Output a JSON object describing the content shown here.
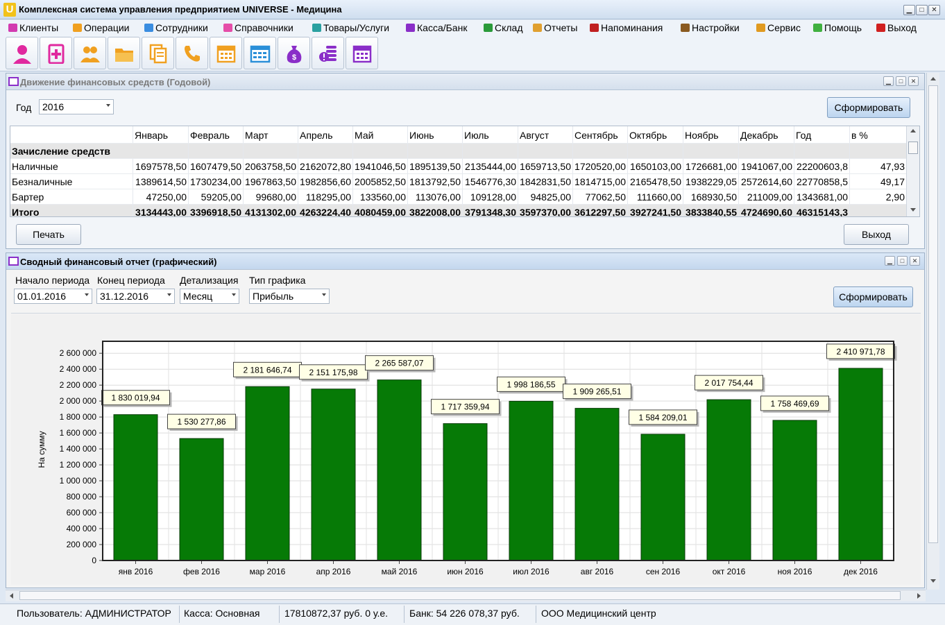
{
  "window": {
    "title": "Комплексная система управления предприятием UNIVERSE - Медицина",
    "logo_letter": "U"
  },
  "menu": [
    {
      "label": "Клиенты",
      "icon": "clients-icon",
      "color": "#d23bb0"
    },
    {
      "label": "Операции",
      "icon": "operations-icon",
      "color": "#f0a020"
    },
    {
      "label": "Сотрудники",
      "icon": "employees-icon",
      "color": "#3a8de0"
    },
    {
      "label": "Справочники",
      "icon": "directories-icon",
      "color": "#e54da8"
    },
    {
      "label": "Товары/Услуги",
      "icon": "goods-icon",
      "color": "#2aa0a0"
    },
    {
      "label": "Касса/Банк",
      "icon": "cash-bank-icon",
      "color": "#8a2ec8"
    },
    {
      "label": "Склад",
      "icon": "warehouse-icon",
      "color": "#2a9a3a"
    },
    {
      "label": "Отчеты",
      "icon": "reports-icon",
      "color": "#e0a030"
    },
    {
      "label": "Напоминания",
      "icon": "reminders-icon",
      "color": "#c02020"
    },
    {
      "label": "Настройки",
      "icon": "settings-icon",
      "color": "#8a5a20"
    },
    {
      "label": "Сервис",
      "icon": "service-icon",
      "color": "#e09a20"
    },
    {
      "label": "Помощь",
      "icon": "help-icon",
      "color": "#40b040"
    },
    {
      "label": "Выход",
      "icon": "exit-icon",
      "color": "#d02020"
    }
  ],
  "toolbar": [
    {
      "icon": "client-person-icon",
      "color": "#e0299f"
    },
    {
      "icon": "medical-card-icon",
      "color": "#e0299f"
    },
    {
      "icon": "staff-group-icon",
      "color": "#f0a020"
    },
    {
      "icon": "folder-icon",
      "color": "#f0a020"
    },
    {
      "icon": "documents-icon",
      "color": "#f0a020"
    },
    {
      "icon": "phone-icon",
      "color": "#f0a020"
    },
    {
      "icon": "calendar-icon",
      "color": "#f0a020"
    },
    {
      "icon": "schedule-grid-icon",
      "color": "#2a8fd8"
    },
    {
      "icon": "money-bag-icon",
      "color": "#8a2ec8"
    },
    {
      "icon": "coins-warning-icon",
      "color": "#8a2ec8"
    },
    {
      "icon": "calendar-purple-icon",
      "color": "#8a2ec8"
    }
  ],
  "finance_frame": {
    "title": "Движение финансовых средств (Годовой)",
    "year_label": "Год",
    "year_value": "2016",
    "generate_label": "Сформировать",
    "print_label": "Печать",
    "exit_label": "Выход",
    "columns": [
      "",
      "Январь",
      "Февраль",
      "Март",
      "Апрель",
      "Май",
      "Июнь",
      "Июль",
      "Август",
      "Сентябрь",
      "Октябрь",
      "Ноябрь",
      "Декабрь",
      "Год",
      "в %"
    ],
    "rows": [
      {
        "type": "group",
        "cells": [
          "Зачисление средств",
          "",
          "",
          "",
          "",
          "",
          "",
          "",
          "",
          "",
          "",
          "",
          "",
          "",
          ""
        ]
      },
      {
        "type": "data",
        "cells": [
          "Наличные",
          "1697578,50",
          "1607479,50",
          "2063758,50",
          "2162072,80",
          "1941046,50",
          "1895139,50",
          "2135444,00",
          "1659713,50",
          "1720520,00",
          "1650103,00",
          "1726681,00",
          "1941067,00",
          "22200603,8",
          "47,93"
        ]
      },
      {
        "type": "data",
        "cells": [
          "Безналичные",
          "1389614,50",
          "1730234,00",
          "1967863,50",
          "1982856,60",
          "2005852,50",
          "1813792,50",
          "1546776,30",
          "1842831,50",
          "1814715,00",
          "2165478,50",
          "1938229,05",
          "2572614,60",
          "22770858,5",
          "49,17"
        ]
      },
      {
        "type": "data",
        "cells": [
          "Бартер",
          "47250,00",
          "59205,00",
          "99680,00",
          "118295,00",
          "133560,00",
          "113076,00",
          "109128,00",
          "94825,00",
          "77062,50",
          "111660,00",
          "168930,50",
          "211009,00",
          "1343681,00",
          "2,90"
        ]
      },
      {
        "type": "total",
        "cells": [
          "Итого",
          "3134443,00",
          "3396918,50",
          "4131302,00",
          "4263224,40",
          "4080459,00",
          "3822008,00",
          "3791348,30",
          "3597370,00",
          "3612297,50",
          "3927241,50",
          "3833840,55",
          "4724690,60",
          "46315143,3",
          ""
        ]
      }
    ]
  },
  "report_frame": {
    "title": "Сводный финансовый отчет (графический)",
    "start_label": "Начало периода",
    "start_value": "01.01.2016",
    "end_label": "Конец периода",
    "end_value": "31.12.2016",
    "detail_label": "Детализация",
    "detail_value": "Месяц",
    "type_label": "Тип графика",
    "type_value": "Прибыль",
    "generate_label": "Сформировать"
  },
  "chart_data": {
    "type": "bar",
    "title": "",
    "xlabel": "",
    "ylabel": "На сумму",
    "ylim": [
      0,
      2750000
    ],
    "yticks": [
      0,
      200000,
      400000,
      600000,
      800000,
      1000000,
      1200000,
      1400000,
      1600000,
      1800000,
      2000000,
      2200000,
      2400000,
      2600000
    ],
    "ytick_labels": [
      "0",
      "200 000",
      "400 000",
      "600 000",
      "800 000",
      "1 000 000",
      "1 200 000",
      "1 400 000",
      "1 600 000",
      "1 800 000",
      "2 000 000",
      "2 200 000",
      "2 400 000",
      "2 600 000"
    ],
    "categories": [
      "янв 2016",
      "фев 2016",
      "мар 2016",
      "апр 2016",
      "май 2016",
      "июн 2016",
      "июл 2016",
      "авг 2016",
      "сен 2016",
      "окт 2016",
      "ноя 2016",
      "дек 2016"
    ],
    "values": [
      1830019.94,
      1530277.86,
      2181646.74,
      2151175.98,
      2265587.07,
      1717359.94,
      1998186.55,
      1909265.51,
      1584209.01,
      2017754.44,
      1758469.69,
      2410971.78
    ],
    "value_labels": [
      "1 830 019,94",
      "1 530 277,86",
      "2 181 646,74",
      "2 151 175,98",
      "2 265 587,07",
      "1 717 359,94",
      "1 998 186,55",
      "1 909 265,51",
      "1 584 209,01",
      "2 017 754,44",
      "1 758 469,69",
      "2 410 971,78"
    ],
    "bar_color": "#067a06",
    "grid": true
  },
  "status": {
    "user": "Пользователь: АДМИНИСТРАТОР",
    "cash": "Касса: Основная",
    "cash_amount": "17810872,37 руб. 0 у.е.",
    "bank": "Банк: 54 226 078,37 руб.",
    "org": "ООО Медицинский центр"
  }
}
